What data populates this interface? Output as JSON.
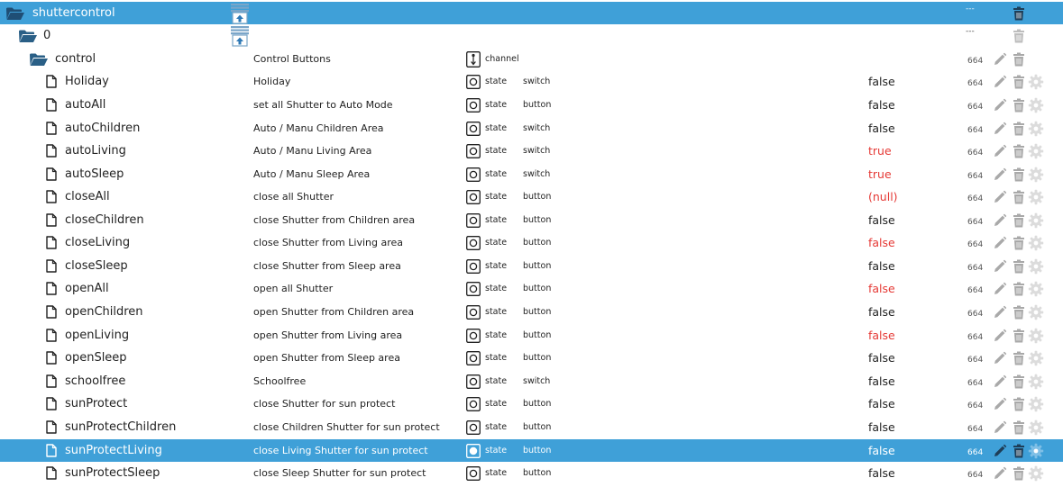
{
  "colors": {
    "selected_bg": "#3fa0d8",
    "red_value": "#e53935",
    "icon_grey": "#a9a9a9",
    "folder": "#2a5f86"
  },
  "rows": [
    {
      "kind": "root",
      "depth": 0,
      "name": "shuttercontrol",
      "icon": "folder-open-icon",
      "num": "---",
      "upload": true,
      "selected": true
    },
    {
      "kind": "folder",
      "depth": 1,
      "name": "0",
      "icon": "folder-open-icon",
      "num": "---",
      "upload": true
    },
    {
      "kind": "channel",
      "depth": 2,
      "name": "control",
      "icon": "folder-open-icon",
      "desc": "Control Buttons",
      "type": "channel",
      "num": "664"
    },
    {
      "kind": "state",
      "name": "Holiday",
      "desc": "Holiday",
      "type": "state",
      "role": "switch",
      "value": "false",
      "num": "664"
    },
    {
      "kind": "state",
      "name": "autoAll",
      "desc": "set all Shutter to Auto Mode",
      "type": "state",
      "role": "button",
      "value": "false",
      "num": "664"
    },
    {
      "kind": "state",
      "name": "autoChildren",
      "desc": "Auto / Manu Children Area",
      "type": "state",
      "role": "switch",
      "value": "false",
      "num": "664"
    },
    {
      "kind": "state",
      "name": "autoLiving",
      "desc": "Auto / Manu Living Area",
      "type": "state",
      "role": "switch",
      "value": "true",
      "red": true,
      "num": "664"
    },
    {
      "kind": "state",
      "name": "autoSleep",
      "desc": "Auto / Manu Sleep Area",
      "type": "state",
      "role": "switch",
      "value": "true",
      "red": true,
      "num": "664"
    },
    {
      "kind": "state",
      "name": "closeAll",
      "desc": "close all Shutter",
      "type": "state",
      "role": "button",
      "value": "(null)",
      "red": true,
      "num": "664"
    },
    {
      "kind": "state",
      "name": "closeChildren",
      "desc": "close Shutter from Children area",
      "type": "state",
      "role": "button",
      "value": "false",
      "num": "664"
    },
    {
      "kind": "state",
      "name": "closeLiving",
      "desc": "close Shutter from Living area",
      "type": "state",
      "role": "button",
      "value": "false",
      "red": true,
      "num": "664"
    },
    {
      "kind": "state",
      "name": "closeSleep",
      "desc": "close Shutter from Sleep area",
      "type": "state",
      "role": "button",
      "value": "false",
      "num": "664"
    },
    {
      "kind": "state",
      "name": "openAll",
      "desc": "open all Shutter",
      "type": "state",
      "role": "button",
      "value": "false",
      "red": true,
      "num": "664"
    },
    {
      "kind": "state",
      "name": "openChildren",
      "desc": "open Shutter from Children area",
      "type": "state",
      "role": "button",
      "value": "false",
      "num": "664"
    },
    {
      "kind": "state",
      "name": "openLiving",
      "desc": "open Shutter from Living area",
      "type": "state",
      "role": "button",
      "value": "false",
      "red": true,
      "num": "664"
    },
    {
      "kind": "state",
      "name": "openSleep",
      "desc": "open Shutter from Sleep area",
      "type": "state",
      "role": "button",
      "value": "false",
      "num": "664"
    },
    {
      "kind": "state",
      "name": "schoolfree",
      "desc": "Schoolfree",
      "type": "state",
      "role": "switch",
      "value": "false",
      "num": "664"
    },
    {
      "kind": "state",
      "name": "sunProtect",
      "desc": "close Shutter for sun protect",
      "type": "state",
      "role": "button",
      "value": "false",
      "num": "664"
    },
    {
      "kind": "state",
      "name": "sunProtectChildren",
      "desc": "close Children Shutter for sun protect",
      "type": "state",
      "role": "button",
      "value": "false",
      "num": "664"
    },
    {
      "kind": "state",
      "name": "sunProtectLiving",
      "desc": "close Living Shutter for sun protect",
      "type": "state",
      "role": "button",
      "value": "false",
      "num": "664",
      "selected": true
    },
    {
      "kind": "state",
      "name": "sunProtectSleep",
      "desc": "close Sleep Shutter for sun protect",
      "type": "state",
      "role": "button",
      "value": "false",
      "num": "664"
    }
  ]
}
